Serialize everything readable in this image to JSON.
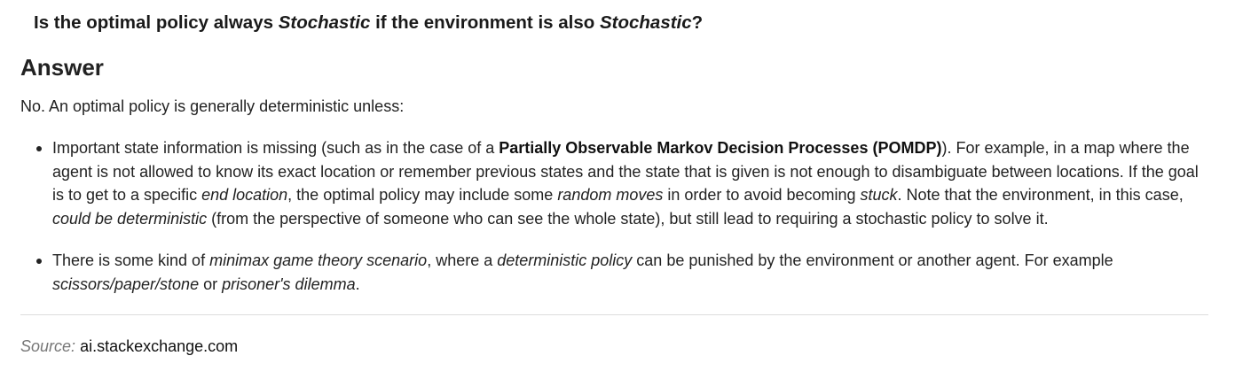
{
  "question": {
    "parts": [
      {
        "text": "Is the optimal policy always ",
        "italic": false
      },
      {
        "text": "Stochastic",
        "italic": true
      },
      {
        "text": " if the environment is also ",
        "italic": false
      },
      {
        "text": "Stochastic",
        "italic": true
      },
      {
        "text": "?",
        "italic": false
      }
    ]
  },
  "answer": {
    "heading": "Answer",
    "intro": "No. An optimal policy is generally deterministic unless:",
    "bullets": [
      {
        "lines": [
          [
            {
              "text": "Important state information is missing (such as in the case of a ",
              "style": "normal"
            },
            {
              "text": "Partially Observable Markov Decision Processes (POMDP)",
              "style": "bold"
            },
            {
              "text": "). For example, in a map where the",
              "style": "normal"
            }
          ],
          [
            {
              "text": "agent is not allowed to know its exact location or remember previous states and the state that is given is not enough to disambiguate between locations. If the goal",
              "style": "normal"
            }
          ],
          [
            {
              "text": "is to get to a specific ",
              "style": "normal"
            },
            {
              "text": "end location",
              "style": "italic"
            },
            {
              "text": ", the optimal policy may include some ",
              "style": "normal"
            },
            {
              "text": "random moves",
              "style": "italic"
            },
            {
              "text": " in order to avoid becoming ",
              "style": "normal"
            },
            {
              "text": "stuck",
              "style": "italic"
            },
            {
              "text": ". Note that the environment, in this case,",
              "style": "normal"
            }
          ],
          [
            {
              "text": "could be deterministic",
              "style": "italic"
            },
            {
              "text": " (from the perspective of someone who can see the whole state), but still lead to requiring a stochastic policy to solve it.",
              "style": "normal"
            }
          ]
        ]
      },
      {
        "lines": [
          [
            {
              "text": "There is some kind of ",
              "style": "normal"
            },
            {
              "text": "minimax game theory scenario",
              "style": "italic"
            },
            {
              "text": ", where a ",
              "style": "normal"
            },
            {
              "text": "deterministic policy",
              "style": "italic"
            },
            {
              "text": " can be punished by the environment or another agent. For example",
              "style": "normal"
            }
          ],
          [
            {
              "text": "scissors/paper/stone",
              "style": "italic"
            },
            {
              "text": " or ",
              "style": "normal"
            },
            {
              "text": "prisoner's dilemma",
              "style": "italic"
            },
            {
              "text": ".",
              "style": "normal"
            }
          ]
        ]
      }
    ]
  },
  "source": {
    "label": "Source:",
    "link": "ai.stackexchange.com"
  },
  "colors": {
    "text": "#222222",
    "source_label": "#777777",
    "divider": "#dcdcdc",
    "heading_underline": "#f2dbe4"
  }
}
